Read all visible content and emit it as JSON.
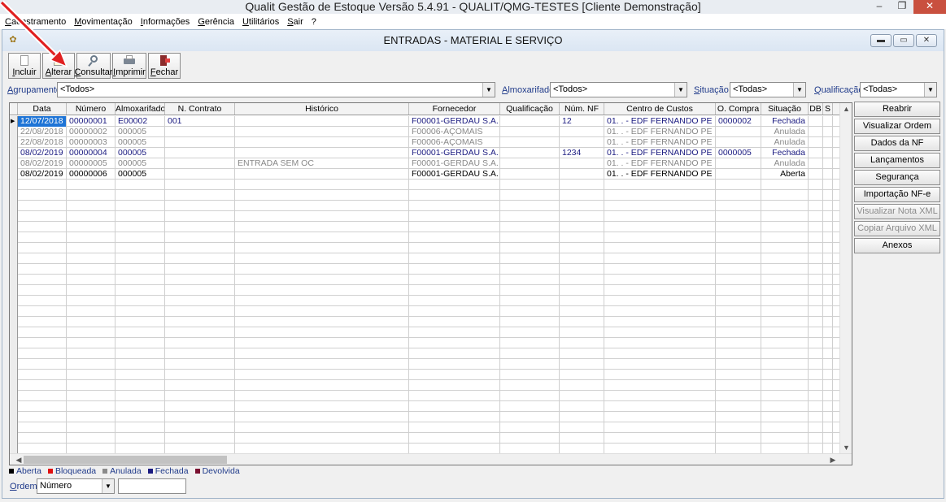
{
  "app": {
    "title": "Qualit Gestão de Estoque Versão 5.4.91 - QUALIT/QMG-TESTES [Cliente Demonstração]",
    "window_controls": {
      "minimize": "–",
      "restore": "❐",
      "close": "✕"
    }
  },
  "menu": [
    "Cadastramento",
    "Movimentação",
    "Informações",
    "Gerência",
    "Utilitários",
    "Sair",
    "?"
  ],
  "child": {
    "title": "ENTRADAS - MATERIAL E SERVIÇO",
    "controls": {
      "minimize": "▬",
      "restore": "▭",
      "close": "✕"
    }
  },
  "toolbar": {
    "incluir": "Incluir",
    "alterar": "Alterar",
    "consultar": "Consultar",
    "imprimir": "Imprimir",
    "fechar": "Fechar"
  },
  "filters": {
    "agrupamento_label": "Agrupamento",
    "agrupamento_value": "<Todos>",
    "almoxarifado_label": "Almoxarifado",
    "almoxarifado_value": "<Todos>",
    "situacao_label": "Situação",
    "situacao_value": "<Todas>",
    "qualificacao_label": "Qualificação",
    "qualificacao_value": "<Todas>"
  },
  "grid": {
    "columns": [
      "Data",
      "Número",
      "Almoxarifado",
      "N. Contrato",
      "Histórico",
      "Fornecedor",
      "Qualificação",
      "Núm. NF",
      "Centro de Custos",
      "O. Compra",
      "Situação",
      "DB",
      "S"
    ],
    "rows": [
      [
        "12/07/2018",
        "00000001",
        "E00002",
        "001",
        "",
        "F00001-GERDAU S.A.",
        "",
        "12",
        "01.   .     - EDF FERNANDO PE",
        "0000002",
        "Fechada"
      ],
      [
        "22/08/2018",
        "00000002",
        "000005",
        "",
        "",
        "F00006-AÇOMAIS",
        "",
        "",
        "01.   .     - EDF FERNANDO PE",
        "",
        "Anulada"
      ],
      [
        "22/08/2018",
        "00000003",
        "000005",
        "",
        "",
        "F00006-AÇOMAIS",
        "",
        "",
        "01.   .     - EDF FERNANDO PE",
        "",
        "Anulada"
      ],
      [
        "08/02/2019",
        "00000004",
        "000005",
        "",
        "",
        "F00001-GERDAU S.A.",
        "",
        "1234",
        "01.   .     - EDF FERNANDO PE",
        "0000005",
        "Fechada"
      ],
      [
        "08/02/2019",
        "00000005",
        "000005",
        "",
        "ENTRADA SEM OC",
        "F00001-GERDAU S.A.",
        "",
        "",
        "01.   .     - EDF FERNANDO PE",
        "",
        "Anulada"
      ],
      [
        "08/02/2019",
        "00000006",
        "000005",
        "",
        "",
        "F00001-GERDAU S.A.",
        "",
        "",
        "01.   .     - EDF FERNANDO PE",
        "",
        "Aberta"
      ]
    ]
  },
  "side_buttons": [
    {
      "label": "Reabrir",
      "enabled": true
    },
    {
      "label": "Visualizar Ordem",
      "enabled": true
    },
    {
      "label": "Dados da NF",
      "enabled": true
    },
    {
      "label": "Lançamentos",
      "enabled": true
    },
    {
      "label": "Segurança",
      "enabled": true
    },
    {
      "label": "Importação NF-e",
      "enabled": true
    },
    {
      "label": "Visualizar Nota XML",
      "enabled": false
    },
    {
      "label": "Copiar Arquivo XML",
      "enabled": false
    },
    {
      "label": "Anexos",
      "enabled": true
    }
  ],
  "legend": [
    {
      "label": "Aberta",
      "color": "#000000"
    },
    {
      "label": "Bloqueada",
      "color": "#e01010"
    },
    {
      "label": "Anulada",
      "color": "#8a8a8a"
    },
    {
      "label": "Fechada",
      "color": "#1a1a80"
    },
    {
      "label": "Devolvida",
      "color": "#7a1030"
    }
  ],
  "ordem": {
    "label": "Ordem",
    "value": "Número",
    "search_value": ""
  },
  "colors": {
    "selection": "#1e74d6",
    "annotation_arrow": "#e02020"
  }
}
